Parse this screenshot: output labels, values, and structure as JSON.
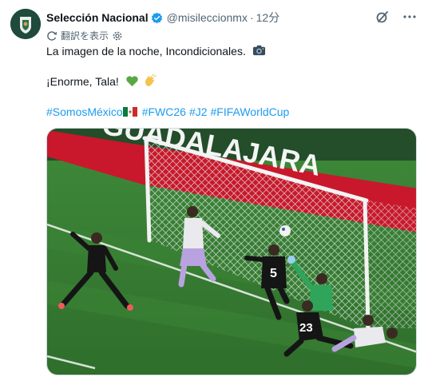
{
  "account": {
    "display_name": "Selección Nacional",
    "handle": "@misileccionmx",
    "separator": "·",
    "timestamp": "12分",
    "verified": true
  },
  "translate": {
    "label": "翻訳を表示"
  },
  "tweet": {
    "line1": "La imagen de la noche, Incondicionales.",
    "line2": "¡Enorme, Tala!",
    "hashtags": [
      "#SomosMéxico",
      "#FWC26",
      "#J2",
      "#FIFAWorldCup"
    ]
  },
  "media": {
    "banner_text": "GUADALAJARA",
    "player_numbers": [
      "5",
      "23"
    ]
  },
  "icons": {
    "grok": "grok-icon",
    "more": "more-icon",
    "translate": "translate-icon",
    "settings": "gear-icon",
    "camera": "camera-emoji",
    "heart": "green-heart-emoji",
    "clap": "clap-emoji",
    "flag": "mexico-flag-emoji"
  },
  "colors": {
    "link": "#1d9bf0",
    "secondary_text": "#536471",
    "verified": "#1d9bf0",
    "avatar_bg": "#1f4a3c"
  }
}
